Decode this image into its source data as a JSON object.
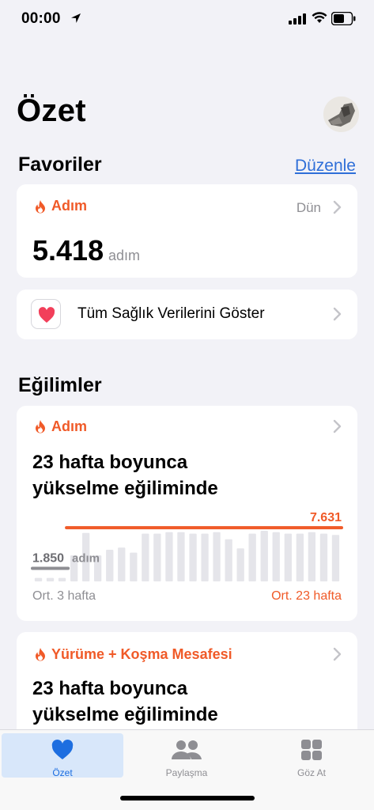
{
  "status_bar": {
    "time": "00:00"
  },
  "header": {
    "title": "Özet"
  },
  "favorites": {
    "title": "Favoriler",
    "edit_label": "Düzenle",
    "steps_card": {
      "label": "Adım",
      "date": "Dün",
      "value": "5.418",
      "unit": "adım"
    },
    "all_data_label": "Tüm Sağlık Verilerini Göster"
  },
  "trends": {
    "title": "Eğilimler",
    "steps": {
      "label": "Adım",
      "headline_line1": "23 hafta boyunca",
      "headline_line2": "yükselme eğiliminde",
      "recent_value": "1.850",
      "recent_unit": "adım",
      "long_value": "7.631",
      "avg_left_label": "Ort. 3 hafta",
      "avg_right_label": "Ort. 23 hafta"
    },
    "distance": {
      "label": "Yürüme + Koşma Mesafesi",
      "headline_line1": "23 hafta boyunca",
      "headline_line2": "yükselme eğiliminde"
    }
  },
  "chart_data": {
    "type": "bar",
    "categories": [
      "1",
      "2",
      "3",
      "4",
      "5",
      "6",
      "7",
      "8",
      "9",
      "10",
      "11",
      "12",
      "13",
      "14",
      "15",
      "16",
      "17",
      "18",
      "19",
      "20",
      "21",
      "22",
      "23",
      "24",
      "25",
      "26"
    ],
    "values": [
      500,
      500,
      500,
      3700,
      6900,
      3700,
      4500,
      4800,
      4100,
      6800,
      6800,
      7000,
      7000,
      6800,
      6800,
      7000,
      6000,
      4700,
      6800,
      7200,
      7000,
      6800,
      6800,
      7000,
      6800,
      6600
    ],
    "ylim": [
      0,
      9000
    ],
    "reference_lines": [
      {
        "label": "1.850",
        "value": 1850,
        "color": "#8e8e93"
      },
      {
        "label": "7.631",
        "value": 7631,
        "color": "#f05a28"
      }
    ],
    "colors": {
      "bar": "#e5e5ea",
      "highlight": "#f05a28",
      "recent": "#8e8e93"
    }
  },
  "tab_bar": {
    "tabs": [
      {
        "label": "Özet",
        "icon": "heart-icon"
      },
      {
        "label": "Paylaşma",
        "icon": "people-icon"
      },
      {
        "label": "Göz At",
        "icon": "grid-icon"
      }
    ]
  }
}
